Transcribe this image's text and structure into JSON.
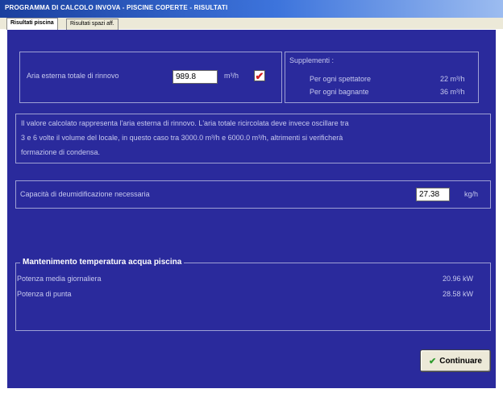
{
  "window": {
    "title": "PROGRAMMA DI CALCOLO INVOVA - PISCINE COPERTE - RISULTATI"
  },
  "tabs": [
    {
      "label": "Risultati piscina"
    },
    {
      "label": "Risultati spazi aff."
    }
  ],
  "air": {
    "label": "Aria esterna totale di rinnovo",
    "value": "989.8",
    "unit": "m³/h",
    "check_mark": "✔"
  },
  "supplements": {
    "title": "Supplementi :",
    "rows": [
      {
        "label": "Per ogni spettatore",
        "value": "22 m³/h"
      },
      {
        "label": "Per ogni bagnante",
        "value": "36 m³/h"
      }
    ]
  },
  "note": {
    "lines": [
      "Il valore calcolato rappresenta l'aria esterna di rinnovo. L'aria totale ricircolata deve invece oscillare tra",
      "3 e 6 volte il volume del locale, in questo caso tra 3000.0 m³/h e 6000.0 m³/h, altrimenti si verificherà",
      "formazione di condensa."
    ]
  },
  "dehumid": {
    "label": "Capacità di deumidificazione necessaria",
    "value": "27.38",
    "unit": "kg/h"
  },
  "maintenance": {
    "legend": "Mantenimento temperatura acqua piscina",
    "rows": [
      {
        "label": "Potenza media giornaliera",
        "value": "20.96 kW"
      },
      {
        "label": "Potenza di punta",
        "value": "28.58 kW"
      }
    ]
  },
  "actions": {
    "continue_label": "Continuare",
    "continue_icon": "check-icon"
  }
}
